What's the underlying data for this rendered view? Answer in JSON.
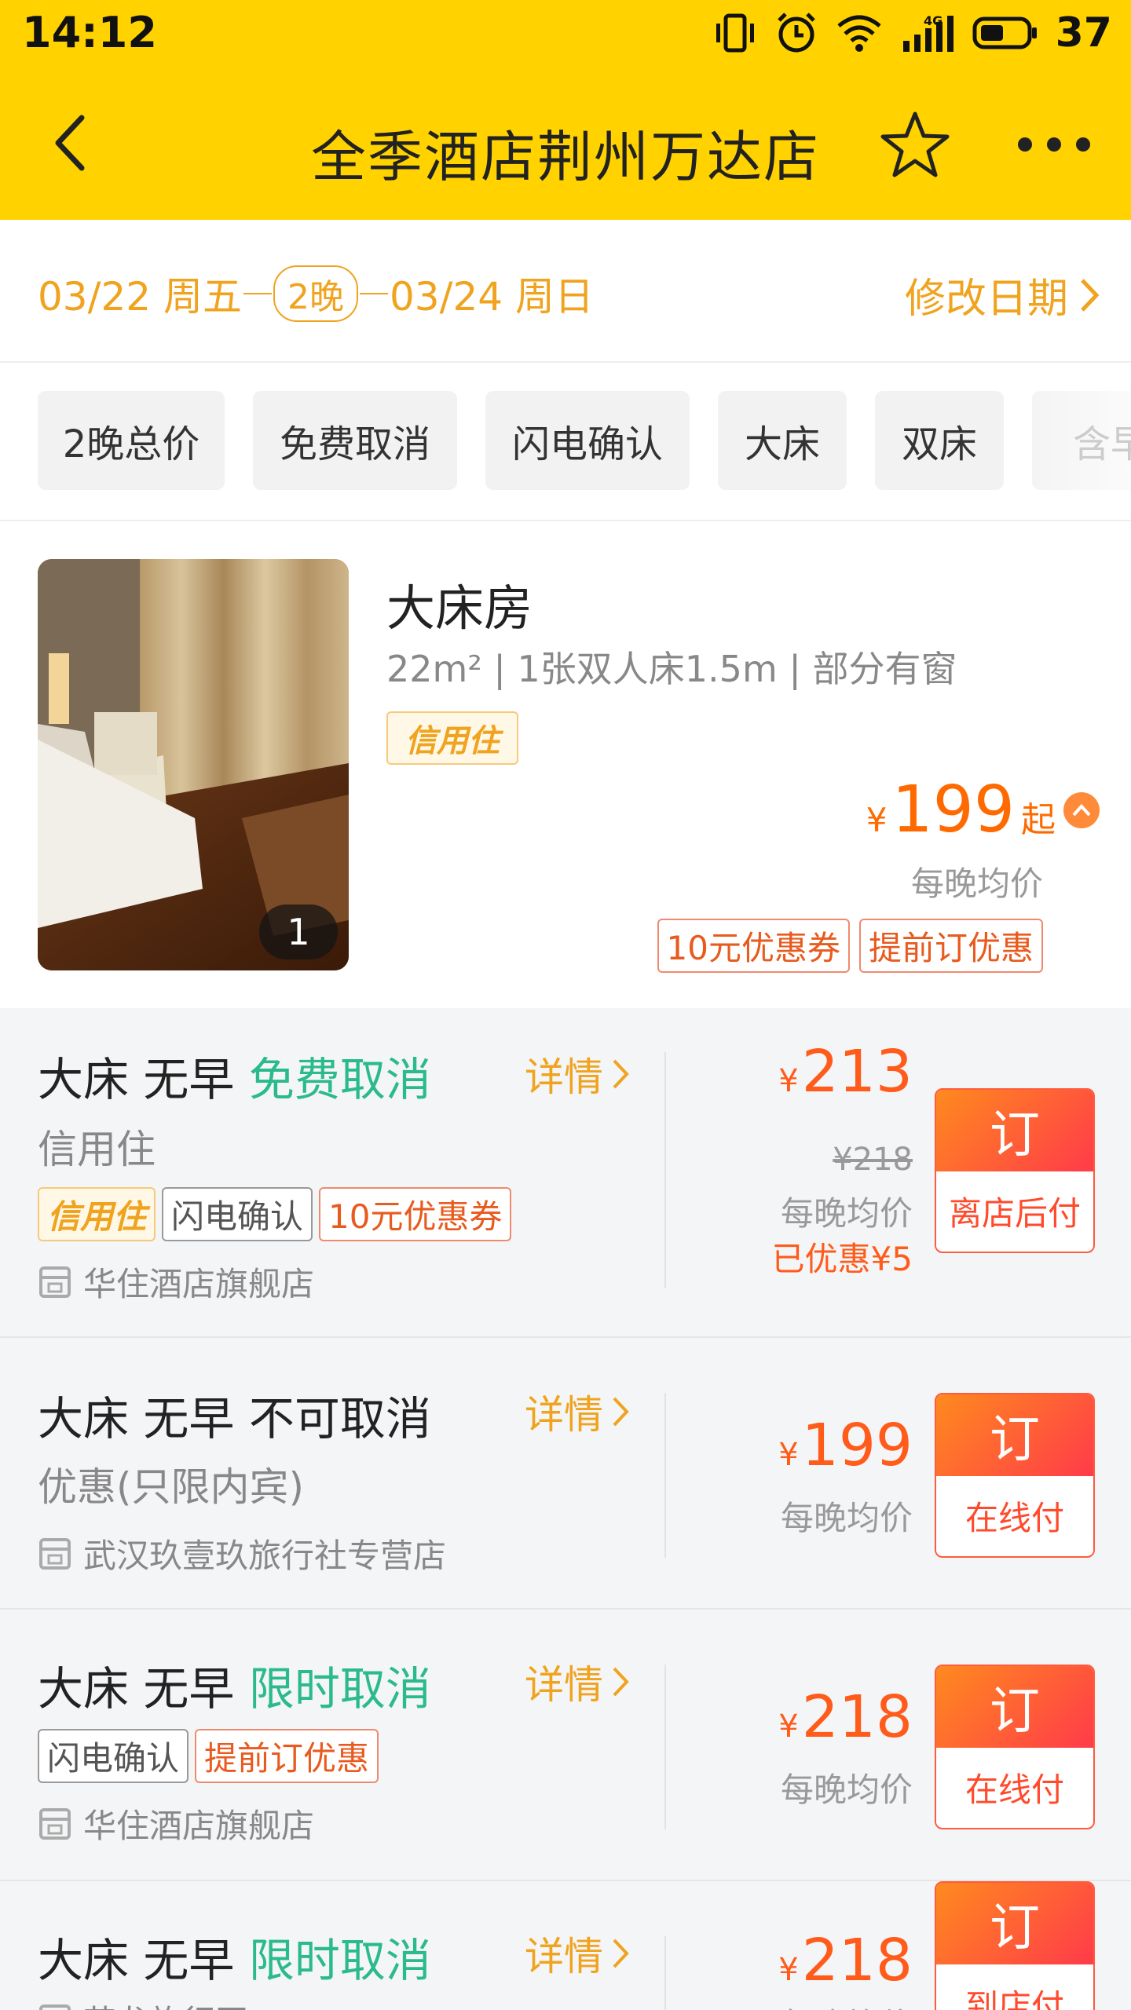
{
  "status_bar": {
    "time": "14:12",
    "network": "4G",
    "battery_pct": "37"
  },
  "nav": {
    "title": "全季酒店荆州万达店"
  },
  "stay": {
    "checkin": "03/22 周五",
    "nights": "2晚",
    "checkout": "03/24 周日",
    "modify_label": "修改日期"
  },
  "filters": [
    "2晚总价",
    "免费取消",
    "闪电确认",
    "大床",
    "双床",
    "含早"
  ],
  "room": {
    "name": "大床房",
    "spec": "22m² | 1张双人床1.5m | 部分有窗",
    "credit_badge": "信用住",
    "currency": "¥",
    "from_price": "199",
    "from_suffix": "起",
    "avg_note": "每晚均价",
    "photo_count": "1",
    "promo_tags": [
      "10元优惠券",
      "提前订优惠"
    ]
  },
  "rates": [
    {
      "title_main": "大床 无早",
      "title_policy": "免费取消",
      "detail": "详情",
      "subtitle": "信用住",
      "tags": [
        "信用住",
        "闪电确认",
        "10元优惠券"
      ],
      "seller": "华住酒店旗舰店",
      "currency": "¥",
      "price": "213",
      "original_price": "¥218",
      "avg": "每晚均价",
      "saved": "已优惠¥5",
      "book_top": "订",
      "book_bottom": "离店后付"
    },
    {
      "title_main": "大床 无早",
      "title_policy": "不可取消",
      "detail": "详情",
      "subtitle": "优惠(只限内宾)",
      "seller": "武汉玖壹玖旅行社专营店",
      "currency": "¥",
      "price": "199",
      "avg": "每晚均价",
      "book_top": "订",
      "book_bottom": "在线付"
    },
    {
      "title_main": "大床 无早",
      "title_policy": "限时取消",
      "detail": "详情",
      "tags": [
        "闪电确认",
        "提前订优惠"
      ],
      "seller": "华住酒店旗舰店",
      "currency": "¥",
      "price": "218",
      "avg": "每晚均价",
      "book_top": "订",
      "book_bottom": "在线付"
    },
    {
      "title_main": "大床 无早",
      "title_policy": "限时取消",
      "detail": "详情",
      "seller": "艺龙旅行网",
      "currency": "¥",
      "price": "218",
      "avg": "每晚均价",
      "book_top": "订",
      "book_bottom": "到店付"
    }
  ],
  "colors": {
    "brand_yellow": "#ffd200",
    "accent_orange": "#f0a31e",
    "price_orange": "#ff5b1a",
    "policy_green": "#2bba8c"
  }
}
